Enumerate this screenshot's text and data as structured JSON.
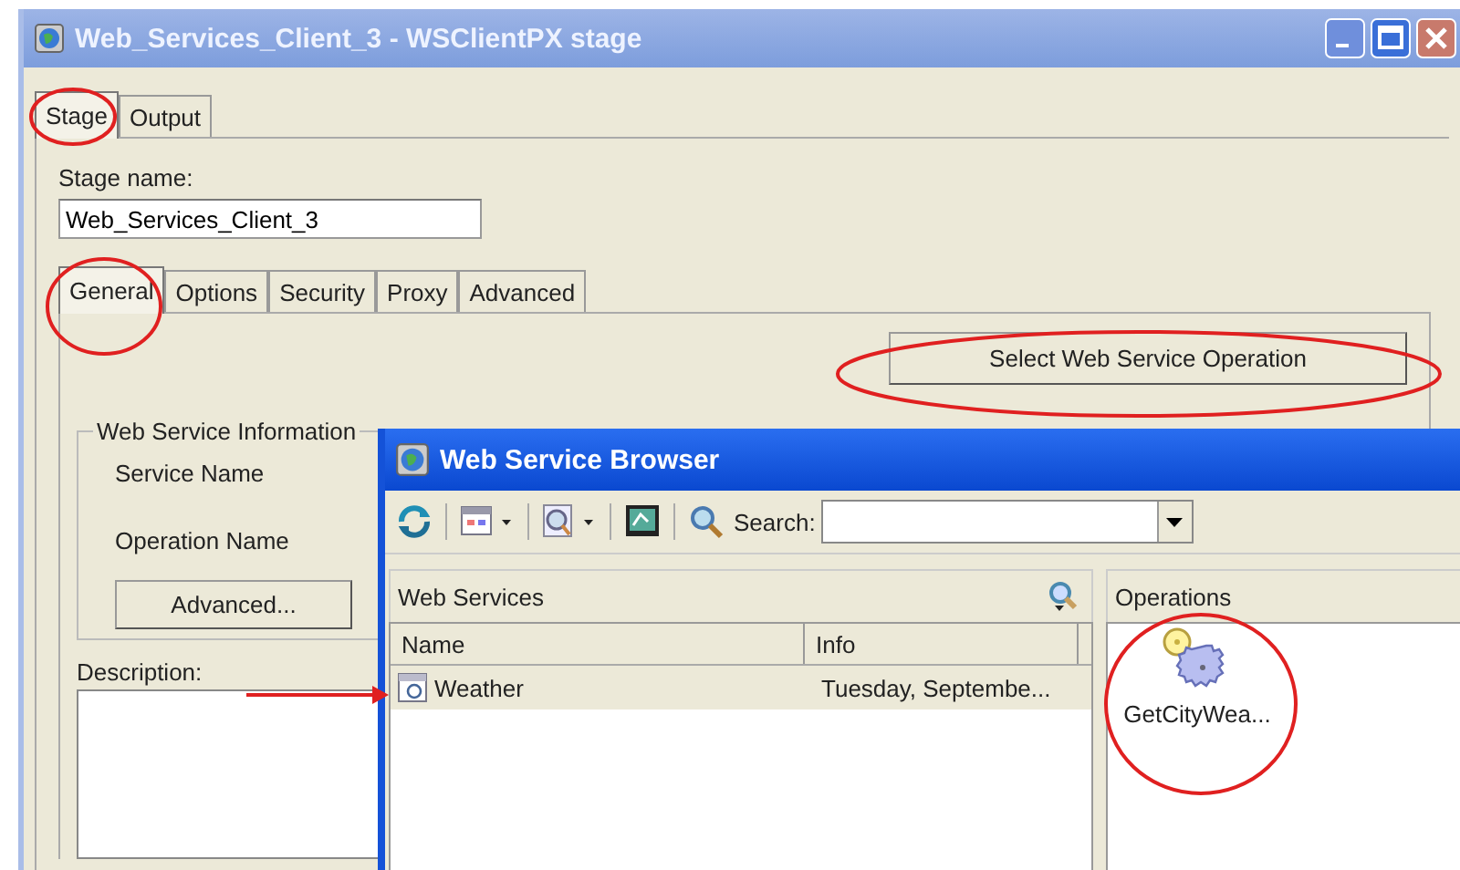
{
  "window": {
    "title": "Web_Services_Client_3 - WSClientPX stage"
  },
  "tabs": [
    {
      "label": "Stage",
      "selected": true
    },
    {
      "label": "Output",
      "selected": false
    }
  ],
  "stage_name": {
    "label": "Stage name:",
    "value": "Web_Services_Client_3"
  },
  "sub_tabs": [
    {
      "label": "General",
      "selected": true
    },
    {
      "label": "Options",
      "selected": false
    },
    {
      "label": "Security",
      "selected": false
    },
    {
      "label": "Proxy",
      "selected": false
    },
    {
      "label": "Advanced",
      "selected": false
    }
  ],
  "select_button": "Select Web Service Operation",
  "web_service_information": {
    "title": "Web Service Information",
    "fields": [
      "Service Name",
      "Operation Name"
    ],
    "button": "Advanced..."
  },
  "description": {
    "label": "Description:"
  },
  "browser": {
    "title": "Web Service Browser",
    "search": {
      "label": "Search:"
    },
    "services": {
      "title": "Web Services",
      "columns": [
        "Name",
        "Info"
      ],
      "rows": [
        {
          "name": "Weather",
          "info": "Tuesday, Septembe...",
          "selected": true
        }
      ]
    },
    "operations": {
      "title": "Operations",
      "items": [
        {
          "label": "GetCityWea..."
        }
      ]
    }
  }
}
